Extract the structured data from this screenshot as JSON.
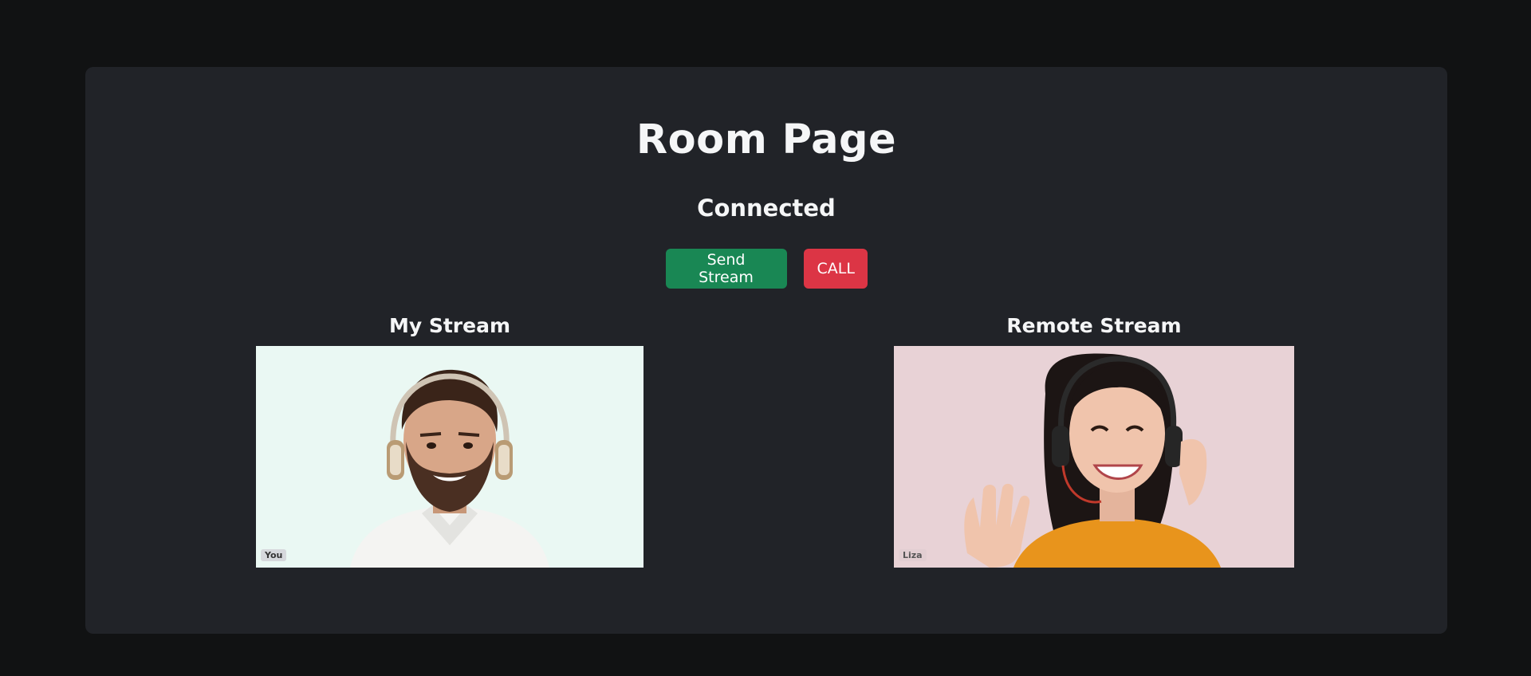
{
  "page": {
    "title": "Room Page",
    "status": "Connected"
  },
  "buttons": {
    "send_stream": "Send Stream",
    "call": "CALL"
  },
  "streams": {
    "my": {
      "heading": "My Stream",
      "label": "You"
    },
    "remote": {
      "heading": "Remote Stream",
      "label": "Liza"
    }
  },
  "colors": {
    "background": "#111213",
    "card": "#212328",
    "send_button": "#198754",
    "call_button": "#dc3545"
  }
}
